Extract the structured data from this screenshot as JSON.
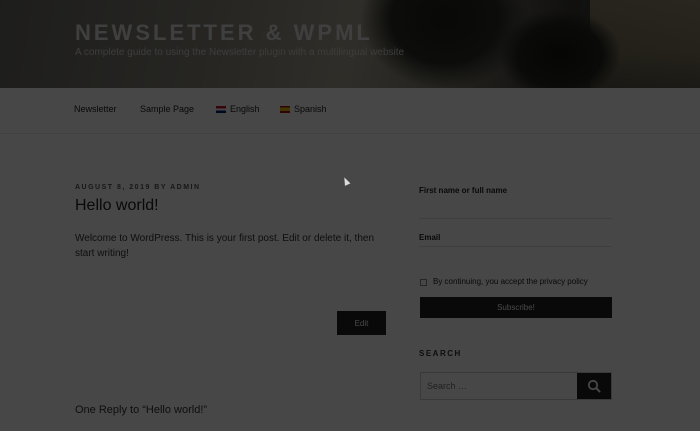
{
  "site": {
    "title": "NEWSLETTER & WPML",
    "description": "A complete guide to using the Newsletter plugin with a multilingual website"
  },
  "nav": {
    "items": [
      {
        "label": "Newsletter"
      },
      {
        "label": "Sample Page"
      },
      {
        "label": "English",
        "icon": "uk-flag-icon"
      },
      {
        "label": "Spanish",
        "icon": "spain-flag-icon"
      }
    ]
  },
  "post": {
    "meta": "AUGUST 8, 2019 BY ADMIN",
    "title": "Hello world!",
    "body": "Welcome to WordPress. This is your first post. Edit or delete it, then start writing!",
    "edit_label": "Edit",
    "reply_text": "One Reply to “Hello world!”"
  },
  "newsletter": {
    "name_label": "First name or full name",
    "email_label": "Email",
    "privacy_text": "By continuing, you accept the privacy policy",
    "subscribe_label": "Subscribe!"
  },
  "search": {
    "heading": "SEARCH",
    "placeholder": "Search …",
    "icon": "search-icon"
  },
  "colors": {
    "overlay": "#000000",
    "button_dark": "#222222"
  }
}
